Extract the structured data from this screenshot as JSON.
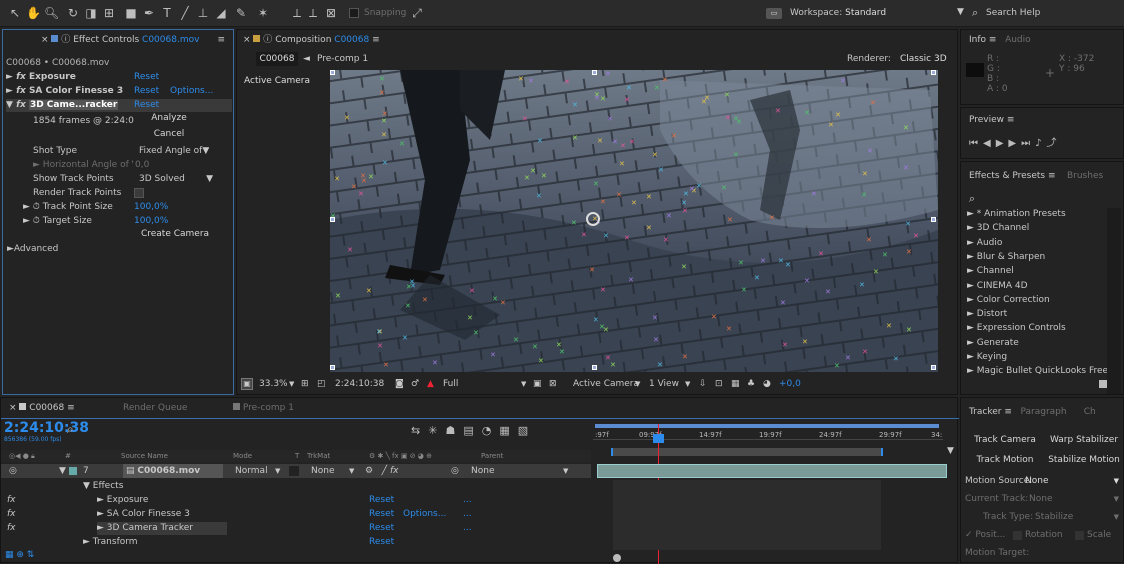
{
  "toolbar": {
    "snapping": "Snapping",
    "workspace_prefix": "Workspace:",
    "workspace": "Standard",
    "search": "Search Help"
  },
  "effect_controls": {
    "title": "Effect Controls",
    "clip": "C00068.mov",
    "breadcrumb": "C00068 • C00068.mov",
    "fx_exposure": "Exposure",
    "fx_color": "SA Color Finesse 3",
    "fx_tracker": "3D Came...racker",
    "reset": "Reset",
    "options": "Options...",
    "frames": "1854 frames @ 2:24:0",
    "analyze": "Analyze",
    "cancel": "Cancel",
    "shot_type_label": "Shot Type",
    "shot_type": "Fixed Angle of",
    "hangle_label": "Horizontal Angle of Vi",
    "hangle": "0,0",
    "show_tp_label": "Show Track Points",
    "show_tp": "3D Solved",
    "render_tp_label": "Render Track Points",
    "tp_size_label": "Track Point Size",
    "tp_size": "100,0%",
    "target_size_label": "Target Size",
    "target_size": "100,0%",
    "create_camera": "Create Camera",
    "advanced": "Advanced"
  },
  "composition": {
    "title": "Composition",
    "comp": "C00068",
    "tab_comp": "C00068",
    "tab_pre": "Pre-comp 1",
    "renderer_label": "Renderer:",
    "renderer": "Classic 3D",
    "active_camera": "Active Camera",
    "zoom": "33.3%",
    "timecode": "2:24:10:38",
    "quality": "Full",
    "camera_dd": "Active Camera",
    "view_dd": "1 View",
    "exposure": "+0,0"
  },
  "info": {
    "tab": "Info",
    "tab2": "Audio",
    "r": "R :",
    "g": "G :",
    "b": "B :",
    "a": "A : 0",
    "x": "X : -372",
    "y": "Y : 96"
  },
  "preview": {
    "tab": "Preview"
  },
  "effects_presets": {
    "tab": "Effects & Presets",
    "tab2": "Brushes",
    "items": [
      "* Animation Presets",
      "3D Channel",
      "Audio",
      "Blur & Sharpen",
      "Channel",
      "CINEMA 4D",
      "Color Correction",
      "Distort",
      "Expression Controls",
      "Generate",
      "Keying",
      "Magic Bullet QuickLooks Free"
    ]
  },
  "timeline": {
    "comp_tab": "C00068",
    "render_queue": "Render Queue",
    "pre_tab": "Pre-comp 1",
    "timecode": "2:24:10:38",
    "fps": "856386 (59.00 fps)",
    "cols": {
      "hash": "#",
      "source": "Source Name",
      "mode": "Mode",
      "t": "T",
      "trkmat": "TrkMat",
      "parent": "Parent"
    },
    "layer_num": "7",
    "layer_name": "C00068.mov",
    "mode": "Normal",
    "trkmat": "None",
    "parent": "None",
    "effects": "Effects",
    "exposure": "Exposure",
    "color": "SA Color Finesse 3",
    "tracker": "3D Camera Tracker",
    "transform": "Transform",
    "reset": "Reset",
    "options": "Options...",
    "dots": "...",
    "ruler": [
      ":97f",
      "09:97f",
      "14:97f",
      "19:97f",
      "24:97f",
      "29:97f",
      "34:"
    ]
  },
  "tracker": {
    "tab": "Tracker",
    "tab2": "Paragraph",
    "tab3": "Ch",
    "track_camera": "Track Camera",
    "warp": "Warp Stabilizer",
    "track_motion": "Track Motion",
    "stabilize": "Stabilize Motion",
    "motion_source_label": "Motion Source:",
    "motion_source": "None",
    "current_track": "Current Track:",
    "current_track_val": "None",
    "track_type": "Track Type:",
    "track_type_val": "Stabilize",
    "position": "Posit...",
    "rotation": "Rotation",
    "scale": "Scale",
    "motion_target": "Motion Target:"
  }
}
